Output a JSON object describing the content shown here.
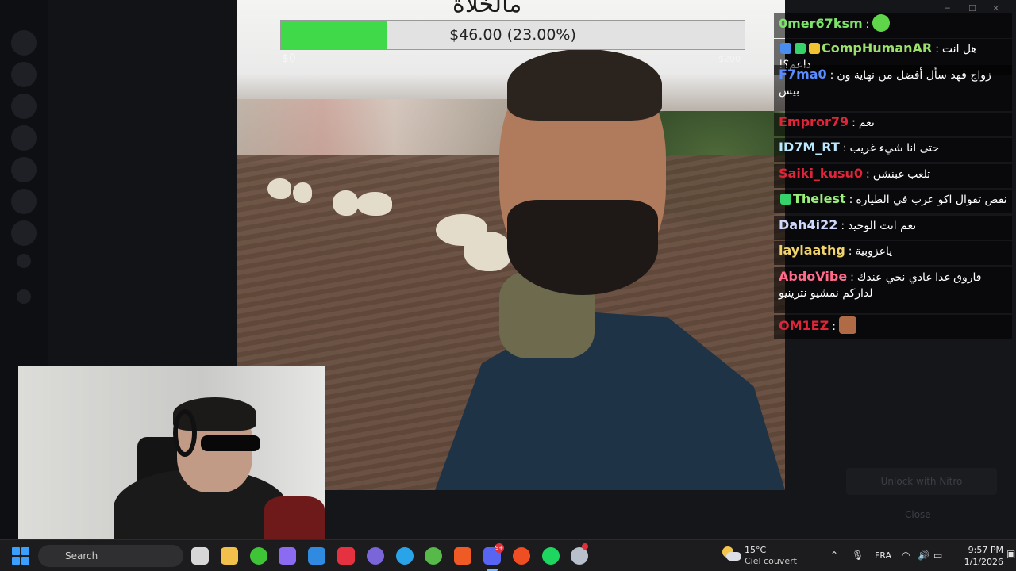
{
  "stream": {
    "goal": {
      "label": "$46.00 (23.00%)",
      "progress": 0.23,
      "min_label": "$0",
      "max_label": "$200",
      "fill_color": "#3fd94a"
    },
    "caption_fragment": "مالخلاة"
  },
  "chat": {
    "messages": [
      {
        "user": "0mer67ksm",
        "user_color": "#7ee36b",
        "text": "",
        "emote": "green-smiley-emote"
      },
      {
        "user": "CompHumanAR",
        "user_color": "#9be06a",
        "text": "هل انت داعم؟!",
        "badges": [
          "sword-badge",
          "diamond-badge",
          "coin-badge"
        ]
      },
      {
        "user": "F7ma0",
        "user_color": "#5b8cff",
        "text": "زواج فهد سأل أفضل من نهاية ون بيس"
      },
      {
        "user": "Empror79",
        "user_color": "#e0243a",
        "text": "نعم"
      },
      {
        "user": "ID7M_RT",
        "user_color": "#b9e8ff",
        "text": "حتى انا شيء غريب"
      },
      {
        "user": "Saiki_kusu0",
        "user_color": "#e0243a",
        "text": "تلعب غبنشن"
      },
      {
        "user": "Thelest",
        "user_color": "#9bf07a",
        "text": "نقص تقوال اكو عرب في الطياره",
        "badges": [
          "diamond-badge"
        ]
      },
      {
        "user": "Dah4i22",
        "user_color": "#cfd9ff",
        "text": "نعم انت الوحيد"
      },
      {
        "user": "laylaathg",
        "user_color": "#f1d36b",
        "text": "ياعزوبية"
      },
      {
        "user": "AbdoVibe",
        "user_color": "#ff6b8a",
        "text": "فاروق غدا غادي نجي عندك لداركم نمشيو نترينيو"
      },
      {
        "user": "OM1EZ",
        "user_color": "#e0243a",
        "text": "",
        "emote": "face-emote"
      }
    ]
  },
  "discord_ghost": {
    "nitro_label": "Unlock with Nitro",
    "close_label": "Close"
  },
  "taskbar": {
    "search_label": "Search",
    "apps": [
      "task-view",
      "file-explorer",
      "xbox",
      "copilot",
      "store",
      "app-red",
      "messaging",
      "telegram",
      "utorrent",
      "brave",
      "discord",
      "ea",
      "spotify",
      "steam"
    ],
    "discord_badge": "9+",
    "weather": {
      "temp": "15°C",
      "condition": "Ciel couvert"
    },
    "language": "FRA",
    "time": "9:57 PM",
    "date": "1/1/2026"
  }
}
